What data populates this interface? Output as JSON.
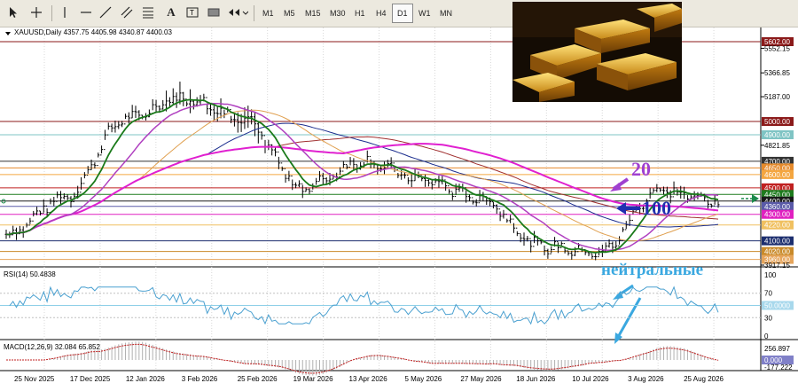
{
  "toolbar": {
    "timeframes": [
      "M1",
      "M5",
      "M15",
      "M30",
      "H1",
      "H4",
      "D1",
      "W1",
      "MN"
    ],
    "active_timeframe": "D1"
  },
  "chart": {
    "symbol_line": "XAUUSD,Daily  4357.75 4405.98 4340.87 4400.03",
    "price_axis": [
      {
        "v": 5602.0,
        "t": "5602.00",
        "bg": "#8b1a1a",
        "fg": "#ffffff"
      },
      {
        "v": 5552.15,
        "t": "5552.15"
      },
      {
        "v": 5366.85,
        "t": "5366.85"
      },
      {
        "v": 5187.0,
        "t": "5187.00"
      },
      {
        "v": 5000.0,
        "t": "5000.00",
        "bg": "#8b1a1a",
        "fg": "#ffffff"
      },
      {
        "v": 4900.0,
        "t": "4900.00",
        "bg": "#7fc4c4",
        "fg": "#ffffff"
      },
      {
        "v": 4821.0,
        "t": "4821.85"
      },
      {
        "v": 4700.0,
        "t": "4700.00",
        "bg": "#333333",
        "fg": "#ffffff"
      },
      {
        "v": 4650.0,
        "t": "4650.00",
        "bg": "#e58a2c",
        "fg": "#ffffff"
      },
      {
        "v": 4600.0,
        "t": "4600.00",
        "bg": "#f4a640",
        "fg": "#ffffff"
      },
      {
        "v": 4500.0,
        "t": "4500.00",
        "bg": "#c02020",
        "fg": "#ffffff"
      },
      {
        "v": 4450.0,
        "t": "4450.00",
        "bg": "#1e7b1e",
        "fg": "#ffffff"
      },
      {
        "v": 4400.0,
        "t": "4400.00",
        "bg": "#1a1a1a",
        "fg": "#ffffff"
      },
      {
        "v": 4360.0,
        "t": "4360.00",
        "bg": "#5a5aa8",
        "fg": "#ffffff"
      },
      {
        "v": 4300.0,
        "t": "4300.00",
        "bg": "#e020c0",
        "fg": "#ffffff"
      },
      {
        "v": 4220.0,
        "t": "4220.00",
        "bg": "#f0c060",
        "fg": "#ffffff"
      },
      {
        "v": 4100.0,
        "t": "4100.00",
        "bg": "#1c2e6e",
        "fg": "#ffffff"
      },
      {
        "v": 4020.0,
        "t": "4020.00",
        "bg": "#c98a2a",
        "fg": "#ffffff"
      },
      {
        "v": 3960.0,
        "t": "3960.00",
        "bg": "#e6a55c",
        "fg": "#ffffff"
      },
      {
        "v": 3917.15,
        "t": "3917.15"
      }
    ],
    "date_axis": [
      "25 Nov 2025",
      "17 Dec 2025",
      "12 Jan 2026",
      "3 Feb 2026",
      "25 Feb 2026",
      "19 Mar 2026",
      "13 Apr 2026",
      "5 May 2026",
      "27 May 2026",
      "18 Jun 2026",
      "10 Jul 2026",
      "3 Aug 2026",
      "25 Aug 2026"
    ],
    "annotations": {
      "ma20": "20",
      "ma100": "100",
      "neutral": "нейтральные"
    }
  },
  "rsi": {
    "label": "RSI(14) 50.4838",
    "levels": [
      "100",
      "70",
      "50.0000",
      "30",
      "0"
    ]
  },
  "macd": {
    "label": "MACD(12,26,9) 32.084 65.852",
    "levels": [
      "256.897",
      "0.000",
      "-177.222"
    ]
  },
  "chart_data": {
    "type": "line",
    "title": "XAUUSD,Daily  4357.75 4405.98 4340.87 4400.03",
    "ylim": [
      3917.15,
      5602.0
    ],
    "x": [
      "25 Nov 2025",
      "17 Dec 2025",
      "12 Jan 2026",
      "3 Feb 2026",
      "25 Feb 2026",
      "19 Mar 2026",
      "13 Apr 2026",
      "5 May 2026",
      "27 May 2026",
      "18 Jun 2026",
      "10 Jul 2026",
      "3 Aug 2026",
      "25 Aug 2026"
    ],
    "series": [
      {
        "name": "",
        "values": [
          4150,
          4430,
          5020,
          5180,
          5010,
          4500,
          4700,
          4560,
          4420,
          4060,
          4010,
          4480,
          4400
        ]
      }
    ],
    "horizontal_levels": [
      5602.0,
      5000.0,
      4900.0,
      4700.0,
      4650.0,
      4600.0,
      4500.0,
      4450.0,
      4400.0,
      4360.0,
      4300.0,
      4220.0,
      4100.0,
      4020.0,
      3960.0
    ],
    "colors": {
      "price": "#000000",
      "ma20": "#1a7a1a",
      "ma_purple": "#b040c0",
      "ma_magenta": "#e020d0",
      "ma_orange": "#e0a050",
      "ma_navy": "#1c2e8e",
      "ma_brown": "#a03030",
      "rsi": "#4aa0d0",
      "annot_purple": "#a040d0",
      "annot_blue": "#2030b0",
      "annot_cyan": "#3aa8e0"
    }
  }
}
